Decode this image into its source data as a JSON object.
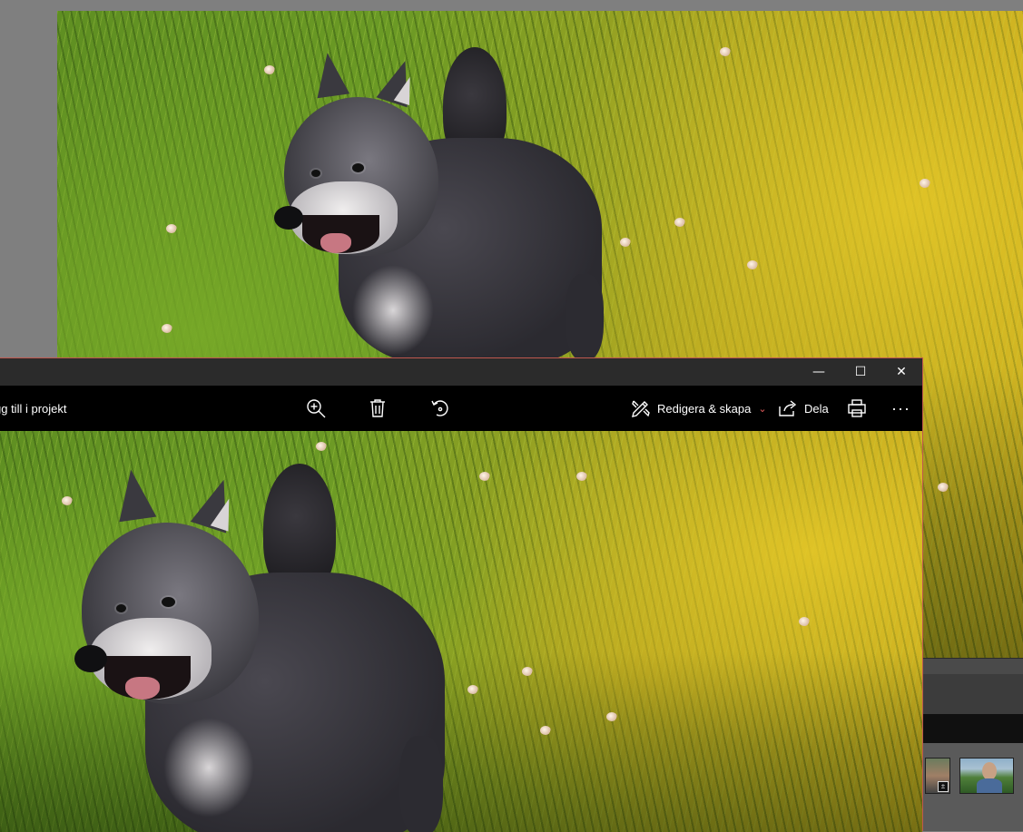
{
  "photos_window": {
    "toolbar": {
      "add_to_project_label": "gg till i projekt",
      "zoom_icon": "zoom-in-icon",
      "delete_icon": "trash-icon",
      "rotate_icon": "rotate-icon",
      "edit_label": "Redigera & skapa",
      "edit_chevron": "⌄",
      "share_label": "Dela",
      "print_icon": "printer-icon",
      "more_label": "···"
    },
    "caption_buttons": {
      "minimize": "—",
      "maximize": "☐",
      "close": "✕"
    },
    "accent_color": "#c0584e"
  },
  "filmstrip": {
    "badge": "±"
  }
}
